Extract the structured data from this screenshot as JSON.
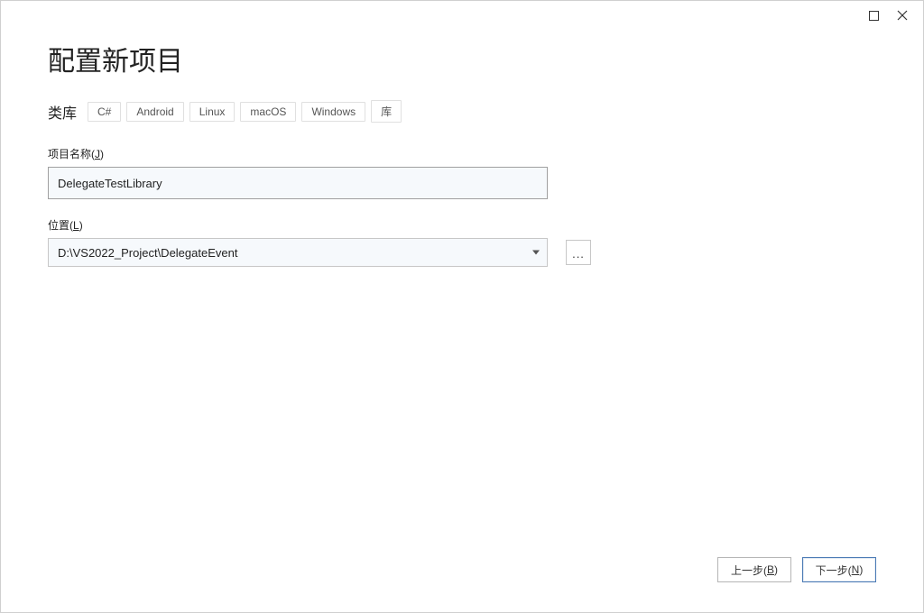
{
  "window": {
    "title": "配置新项目"
  },
  "tags": {
    "template_type": "类库",
    "items": [
      "C#",
      "Android",
      "Linux",
      "macOS",
      "Windows",
      "库"
    ]
  },
  "fields": {
    "project_name": {
      "label_prefix": "项目名称(",
      "label_hotkey": "J",
      "label_suffix": ")",
      "value": "DelegateTestLibrary"
    },
    "location": {
      "label_prefix": "位置(",
      "label_hotkey": "L",
      "label_suffix": ")",
      "value": "D:\\VS2022_Project\\DelegateEvent",
      "browse_label": "..."
    }
  },
  "footer": {
    "back_prefix": "上一步(",
    "back_hotkey": "B",
    "back_suffix": ")",
    "next_prefix": "下一步(",
    "next_hotkey": "N",
    "next_suffix": ")"
  }
}
